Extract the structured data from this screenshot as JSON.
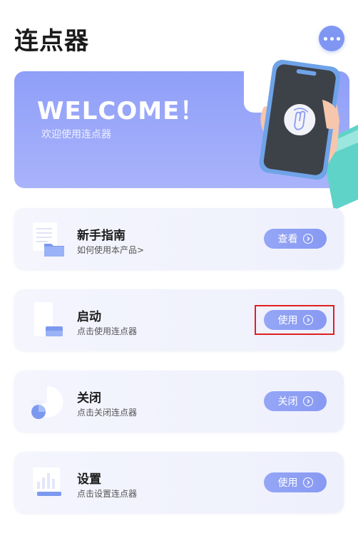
{
  "header": {
    "title": "连点器",
    "more_icon": "more-dots-icon"
  },
  "banner": {
    "headline": "WELCOME！",
    "subtitle": "欢迎使用连点器",
    "phone_icon": "tap-gesture-icon"
  },
  "cards": [
    {
      "title": "新手指南",
      "subtitle": "如何使用本产品>",
      "button": "查看",
      "icon": "document-folder-icon"
    },
    {
      "title": "启动",
      "subtitle": "点击使用连点器",
      "button": "使用",
      "icon": "phone-start-icon"
    },
    {
      "title": "关闭",
      "subtitle": "点击关闭连点器",
      "button": "关闭",
      "icon": "pie-chart-icon"
    },
    {
      "title": "设置",
      "subtitle": "点击设置连点器",
      "button": "使用",
      "icon": "settings-chart-icon"
    }
  ],
  "colors": {
    "accent": "#8799f2",
    "banner": "#9aa8f9",
    "highlight": "#e02020"
  }
}
